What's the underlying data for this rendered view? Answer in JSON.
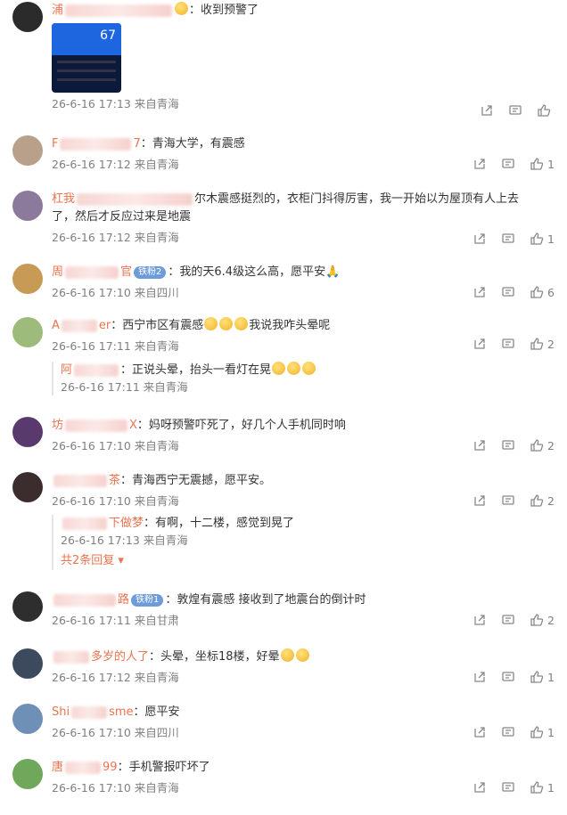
{
  "comments": [
    {
      "name_pre": "浦",
      "name_post": "",
      "text": "：收到预警了",
      "time": "26-6-16 17:13",
      "location": "来自青海",
      "likes": "",
      "image": {
        "number": "67"
      }
    },
    {
      "name_pre": "F",
      "name_post": "7",
      "text": "：青海大学，有震感",
      "time": "26-6-16 17:12",
      "location": "来自青海",
      "likes": "1"
    },
    {
      "name_pre": "杠我",
      "name_post": "",
      "text_line1": "尔木震感挺烈的，衣柜门抖得厉害，我一开始以为屋顶有人上去",
      "text_line2": "了，然后才反应过来是地震",
      "time": "26-6-16 17:12",
      "location": "来自青海",
      "likes": "1"
    },
    {
      "name_pre": "周",
      "name_post": "官",
      "badge": "铁粉2",
      "text": "：我的天6.4级这么高，愿平安🙏",
      "time": "26-6-16 17:10",
      "location": "来自四川",
      "likes": "6"
    },
    {
      "name_pre": "A",
      "name_post": "er",
      "text": "：西宁市区有震感",
      "text_after": "我说我咋头晕呢",
      "time": "26-6-16 17:11",
      "location": "来自青海",
      "likes": "2",
      "reply": {
        "name_pre": "阿",
        "text": "：正说头晕，抬头一看灯在晃",
        "time": "26-6-16 17:11",
        "location": "来自青海"
      }
    },
    {
      "name_pre": "坊",
      "name_post": "X",
      "text": "：妈呀预警吓死了，好几个人手机同时响",
      "time": "26-6-16 17:10",
      "location": "来自青海",
      "likes": "2"
    },
    {
      "name_pre": "",
      "name_post": "茶",
      "text": "：青海西宁无震撼，愿平安。",
      "time": "26-6-16 17:10",
      "location": "来自青海",
      "likes": "2",
      "reply": {
        "name_pre": "下做梦",
        "text": "：有啊，十二楼，感觉到晃了",
        "time": "26-6-16 17:13",
        "location": "来自青海"
      },
      "more": "共2条回复"
    },
    {
      "name_pre": "",
      "name_post": "路",
      "badge": "铁粉1",
      "text": "：敦煌有震感 接收到了地震台的倒计时",
      "time": "26-6-16 17:11",
      "location": "来自甘肃",
      "likes": "2"
    },
    {
      "name_pre": "",
      "name_post": "多岁的人了",
      "text": "：头晕，坐标18楼，好晕",
      "time": "26-6-16 17:12",
      "location": "来自青海",
      "likes": "1"
    },
    {
      "name_pre": "Shi",
      "name_post": "sme",
      "text": "：愿平安",
      "time": "26-6-16 17:10",
      "location": "来自四川",
      "likes": "1"
    },
    {
      "name_pre": "唐",
      "name_post": "99",
      "text": "：手机警报吓坏了",
      "time": "26-6-16 17:10",
      "location": "来自青海",
      "likes": "1"
    }
  ],
  "colors": {
    "username": "#eb7350",
    "meta": "#808080",
    "badge": "#6e9bd9"
  },
  "icons": {
    "share": "share-icon",
    "comment": "comment-icon",
    "like": "like-icon"
  }
}
